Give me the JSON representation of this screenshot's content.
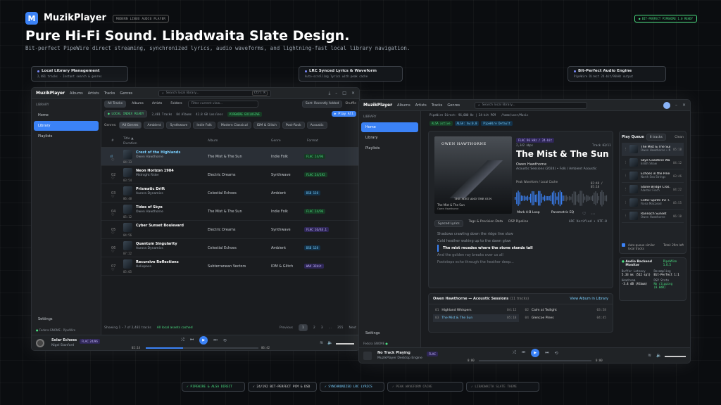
{
  "header": {
    "app": "MuzikPlayer",
    "logo_letter": "M",
    "badge": "MODERN LINUX AUDIO PLAYER",
    "right_badge": "● BIT-PERFECT PIPEWIRE 1.0 READY",
    "title": "Pure Hi-Fi Sound. Libadwaita Slate Design.",
    "subtitle": "Bit-perfect PipeWire direct streaming, synchronized lyrics, audio waveforms, and lightning-fast local library navigation."
  },
  "callouts": [
    {
      "title": "Local Library Management",
      "desc": "2,481 tracks · Instant search & genres"
    },
    {
      "title": "LRC Synced Lyrics & Waveform",
      "desc": "Auto-scrolling lyrics with peak cache"
    },
    {
      "title": "Bit-Perfect Audio Engine",
      "desc": "PipeWire Direct 24-bit/96kHz output"
    }
  ],
  "left": {
    "app": "MuzikPlayer",
    "nav": [
      "Albums",
      "Artists",
      "Tracks",
      "Genres"
    ],
    "search": "Search local library...",
    "kbd": "Ctrl K",
    "sidebar_label": "LIBRARY",
    "sidebar": [
      "Home",
      "Library",
      "Playlists"
    ],
    "settings": "Settings",
    "status": "Fedora GNOME · PipeWire",
    "tabs": [
      "All Tracks",
      "Albums",
      "Artists",
      "Folders"
    ],
    "filter": "Filter current view...",
    "sort": "Sort: Recently Added",
    "shuffle": "Shuffle",
    "stats": [
      "● LOCAL INDEX READY",
      "2,481 Tracks",
      "84 Albums",
      "42.8 GB Lossless",
      "PIPEWIRE EXCLUSIVE"
    ],
    "playall": "▶ Play All",
    "genres_label": "Genres:",
    "genres": [
      "All Genres",
      "Ambient",
      "Synthwave",
      "Indie Folk",
      "Modern Classical",
      "IDM & Glitch",
      "Post-Rock",
      "Acoustic"
    ],
    "cols": [
      "#",
      "Title ▲",
      "Duration",
      "Album",
      "Genre",
      "Format"
    ],
    "rows": [
      {
        "n": "",
        "title": "Crest of the Highlands",
        "artist": "Owen Hawthorne",
        "dur": "04:33",
        "album": "The Mist & The Sun",
        "genre": "Indie Folk",
        "fmt": "FLAC 24/96",
        "k": "g"
      },
      {
        "n": "02",
        "title": "Neon Horizon 1984",
        "artist": "Midnight Rider",
        "dur": "03:54",
        "album": "Electric Dreams",
        "genre": "Synthwave",
        "fmt": "FLAC 24/192",
        "k": "g"
      },
      {
        "n": "03",
        "title": "Prismatic Drift",
        "artist": "Aurora Dynamics",
        "dur": "06:48",
        "album": "Celestial Echoes",
        "genre": "Ambient",
        "fmt": "DSD 128",
        "k": ""
      },
      {
        "n": "04",
        "title": "Tides of Skye",
        "artist": "Owen Hawthorne",
        "dur": "05:12",
        "album": "The Mist & The Sun",
        "genre": "Indie Folk",
        "fmt": "FLAC 24/96",
        "k": "g"
      },
      {
        "n": "05",
        "title": "Cyber Sunset Boulevard",
        "artist": "",
        "dur": "04:56",
        "album": "Electric Dreams",
        "genre": "Synthwave",
        "fmt": "FLAC 16/44.1",
        "k": "p"
      },
      {
        "n": "06",
        "title": "Quantum Singularity",
        "artist": "Aurora Dynamics",
        "dur": "07:22",
        "album": "Celestial Echoes",
        "genre": "Ambient",
        "fmt": "DSD 128",
        "k": ""
      },
      {
        "n": "07",
        "title": "Recursive Reflections",
        "artist": "Helixpace",
        "dur": "05:05",
        "album": "Subterranean Vectors",
        "genre": "IDM & Glitch",
        "fmt": "WAV 32bit",
        "k": "p"
      }
    ],
    "showing": "Showing 1 – 7 of 2,481 tracks",
    "synced": "All local assets cached",
    "pages": [
      "Previous",
      "1",
      "2",
      "3",
      "...",
      "355",
      "Next"
    ],
    "player": {
      "title": "Solar Echoes",
      "artist": "Nigel Stanford",
      "fmt": "FLAC 24/96",
      "cur": "02:14",
      "tot": "06:42"
    }
  },
  "right": {
    "app": "MuzikPlayer",
    "nav": [
      "Albums",
      "Artists",
      "Tracks",
      "Genres"
    ],
    "search": "Search local library...",
    "sidebar_label": "LIBRARY",
    "sidebar": [
      "Home",
      "Library",
      "Playlists"
    ],
    "settings": "Settings",
    "status": "Fedora GNOME",
    "path": "PipeWire Direct: 96,000 Hz | 24-bit PCM",
    "folder": "/home/user/Music",
    "pills": [
      "ALSA active",
      "ALSA: hw:0,0",
      "PipeWire Default"
    ],
    "cover": {
      "title": "OWEN HAWTHORNE",
      "album": "THE MIST AND THE SUN",
      "sub1": "The Mist & The Sun",
      "sub2": "Owen Hawthorne"
    },
    "fmt": "FLAC 96 kHz / 24-bit",
    "kbps": "2,342 kbps",
    "track": "Track 03/11",
    "title": "The Mist & The Sun",
    "artist": "Owen Hawthorne",
    "meta": "Acoustic Sessions (2024) • Folk / Ambient Acoustic",
    "wave_label": "Peak Waveform / Local Cache",
    "wave_time": "02:48 / 05:18",
    "markab": "Mark A-B Loop",
    "eq": "Parametric EQ",
    "ltabs": [
      "Synced Lyrics",
      "Tags & Precision Data",
      "DSP Pipeline"
    ],
    "lrc": "LRC Verified • UTF-8",
    "lyrics": [
      "Shadows crawling down the ridge line slow",
      "Cold heather waking up to the dawn glow",
      "The mist recedes where the stone stands tall",
      "And the golden ray breaks over us all",
      "Footsteps echo through the heather deep..."
    ],
    "album_head": "Owen Hawthorne — Acoustic Sessions",
    "album_count": "(11 tracks)",
    "view_album": "View Album in Library",
    "album_tracks": [
      [
        "01",
        "Highland Whispers",
        "04:12"
      ],
      [
        "02",
        "Calm at Twilight",
        "03:58"
      ],
      [
        "03",
        "The Mist & The Sun",
        "05:18"
      ],
      [
        "04",
        "Glencoe Pines",
        "04:45"
      ]
    ],
    "queue_title": "Play Queue",
    "queue_count": "6 tracks",
    "clear": "Clean",
    "queue": [
      [
        "The Mist & The Sun",
        "Owen Hawthorne • Now Playing",
        "05:18"
      ],
      [
        "Skye Coastline Wa...",
        "Eilidh Shaw",
        "04:12"
      ],
      [
        "Echoes in the Pine",
        "North Sea Strings",
        "03:46"
      ],
      [
        "Stone Bridge Cros...",
        "Alastair Finch",
        "04:22"
      ],
      [
        "Celtic Spirits Inc T...",
        "Fiona MacLeod",
        "05:55"
      ],
      [
        "Rannoch Sunset",
        "Owen Hawthorne",
        "06:10"
      ]
    ],
    "autoq": "Auto-queue similar local tracks",
    "total": "Total: 29m left",
    "monitor_title": "Audio Backend Monitor",
    "monitor_ver": "PipeWire 1.0.5",
    "monitor": [
      [
        "Buffer Latency",
        "5.33 ms (512 spl)"
      ],
      [
        "Resampling",
        "Bit-Perfect 1:1"
      ],
      [
        "Headroom",
        "-3.4 dB (Album)"
      ],
      [
        "DSP State",
        "No clipping (0.0dB)"
      ]
    ],
    "player": {
      "title": "No Track Playing",
      "sub": "MuzikPlayer Desktop Engine",
      "fmt": "FLAC",
      "cur": "0:00",
      "tot": "0:00"
    }
  },
  "footer": [
    "✓ PIPEWIRE & ALSA DIRECT",
    "✓ 24/192 BIT-PERFECT PCM & DSD",
    "✓ SYNCHRONIZED LRC LYRICS",
    "✓ PEAK WAVEFORM CACHE",
    "✓ LIBADWAITA SLATE THEME"
  ],
  "colors": {
    "accent": "#3b82f6",
    "green": "#4ade80",
    "bg": "#0b0d10"
  }
}
